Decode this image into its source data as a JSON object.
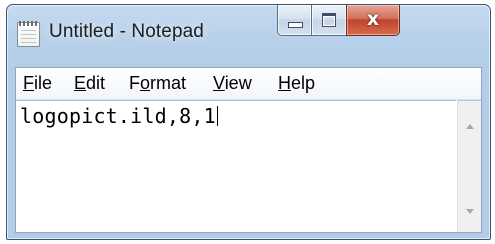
{
  "window": {
    "title": "Untitled - Notepad",
    "close_glyph": "x",
    "accent_color": "#b9d1ea",
    "close_color": "#c0432a"
  },
  "menu": {
    "items": [
      {
        "key": "F",
        "rest": "ile"
      },
      {
        "key": "E",
        "rest": "dit"
      },
      {
        "pre": "F",
        "key": "o",
        "rest": "rmat"
      },
      {
        "key": "V",
        "rest": "iew"
      },
      {
        "key": "H",
        "rest": "elp"
      }
    ]
  },
  "editor": {
    "text": "logopict.ild,8,1"
  },
  "icons": {
    "app": "notepad-icon",
    "minimize": "minimize-icon",
    "maximize": "maximize-icon",
    "close": "close-icon",
    "scroll_up": "scroll-up-arrow-icon",
    "scroll_down": "scroll-down-arrow-icon"
  }
}
